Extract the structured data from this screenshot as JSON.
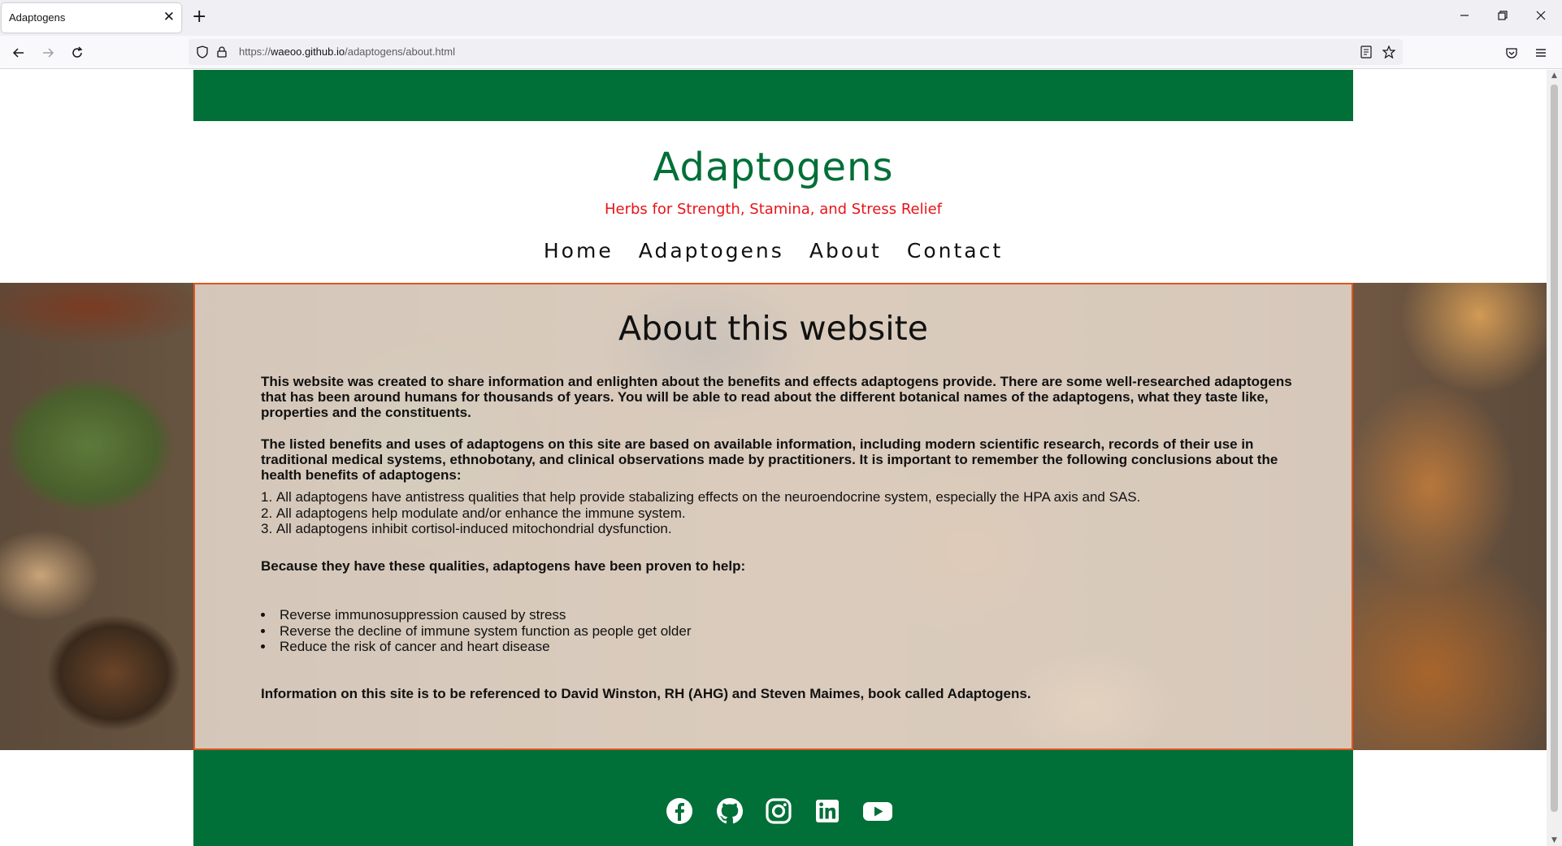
{
  "browser": {
    "tab_title": "Adaptogens",
    "tab_close": "✕",
    "new_tab": "+",
    "url_prefix": "https://",
    "url_host": "waeoo.github.io",
    "url_path": "/adaptogens/about.html"
  },
  "site": {
    "title": "Adaptogens",
    "tagline": "Herbs for Strength, Stamina, and Stress Relief",
    "nav": [
      "Home",
      "Adaptogens",
      "About",
      "Contact"
    ]
  },
  "about": {
    "heading": "About this website",
    "intro": "This website was created to share information and enlighten about the benefits and effects adaptogens provide. There are some well-researched adaptogens that has been around humans for thousands of years. You will be able to read about the different botanical names of the adaptogens, what they taste like, properties and the constituents.",
    "basis": "The listed benefits and uses of adaptogens on this site are based on available information, including modern scientific research, records of their use in traditional medical systems, ethnobotany, and clinical observations made by practitioners. It is important to remember the following conclusions about the health benefits of adaptogens:",
    "conclusions": [
      "All adaptogens have antistress qualities that help provide stabalizing effects on the neuroendocrine system, especially the HPA axis and SAS.",
      "All adaptogens help modulate and/or enhance the immune system.",
      "All adaptogens inhibit cortisol-induced mitochondrial dysfunction."
    ],
    "qualities_intro": "Because they have these qualities, adaptogens have been proven to help:",
    "benefits": [
      "Reverse immunosuppression caused by stress",
      "Reverse the decline of immune system function as people get older",
      "Reduce the risk of cancer and heart disease"
    ],
    "reference": "Information on this site is to be referenced to David Winston, RH (AHG) and Steven Maimes, book called Adaptogens."
  },
  "footer": {
    "social_icons": [
      "facebook-icon",
      "github-icon",
      "instagram-icon",
      "linkedin-icon",
      "youtube-icon"
    ]
  },
  "colors": {
    "brand_green": "#006f38",
    "tagline_red": "#e8131a",
    "panel_border": "#e0551f"
  }
}
